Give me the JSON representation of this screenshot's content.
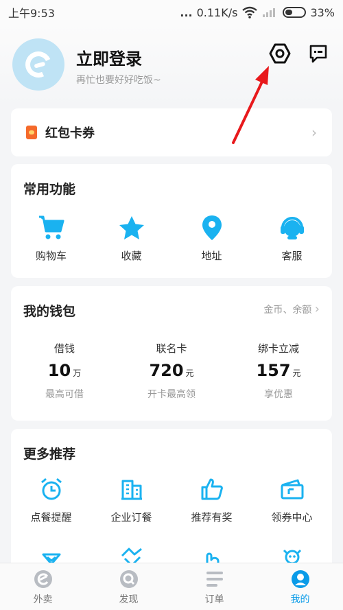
{
  "status_bar": {
    "time": "上午9:53",
    "dots": "...",
    "speed": "0.11K/s",
    "battery": "33%"
  },
  "profile": {
    "title": "立即登录",
    "subtitle": "再忙也要好好吃饭~"
  },
  "icons": {
    "settings": "settings-hexagon-icon",
    "message": "message-icon"
  },
  "red_packet": {
    "label": "红包卡券"
  },
  "common_functions": {
    "title": "常用功能",
    "items": [
      {
        "label": "购物车",
        "icon": "cart-icon"
      },
      {
        "label": "收藏",
        "icon": "star-icon"
      },
      {
        "label": "地址",
        "icon": "location-pin-icon"
      },
      {
        "label": "客服",
        "icon": "headset-icon"
      }
    ]
  },
  "wallet": {
    "title": "我的钱包",
    "link": "金币、余额",
    "items": [
      {
        "label": "借钱",
        "value": "10",
        "unit": "万",
        "note": "最高可借"
      },
      {
        "label": "联名卡",
        "value": "720",
        "unit": "元",
        "note": "开卡最高领"
      },
      {
        "label": "绑卡立减",
        "value": "157",
        "unit": "元",
        "note": "享优惠"
      }
    ]
  },
  "more": {
    "title": "更多推荐",
    "items": [
      {
        "label": "点餐提醒",
        "icon": "alarm-clock-icon"
      },
      {
        "label": "企业订餐",
        "icon": "building-icon"
      },
      {
        "label": "推荐有奖",
        "icon": "thumbs-up-icon"
      },
      {
        "label": "领券中心",
        "icon": "coupon-icon"
      }
    ]
  },
  "nav": {
    "items": [
      {
        "label": "外卖"
      },
      {
        "label": "发现"
      },
      {
        "label": "订单"
      },
      {
        "label": "我的"
      }
    ]
  },
  "colors": {
    "accent": "#0a9be8",
    "icon_blue": "#1ab2f0",
    "red_packet": "#f56a2b",
    "annotation_arrow": "#e8191c"
  }
}
